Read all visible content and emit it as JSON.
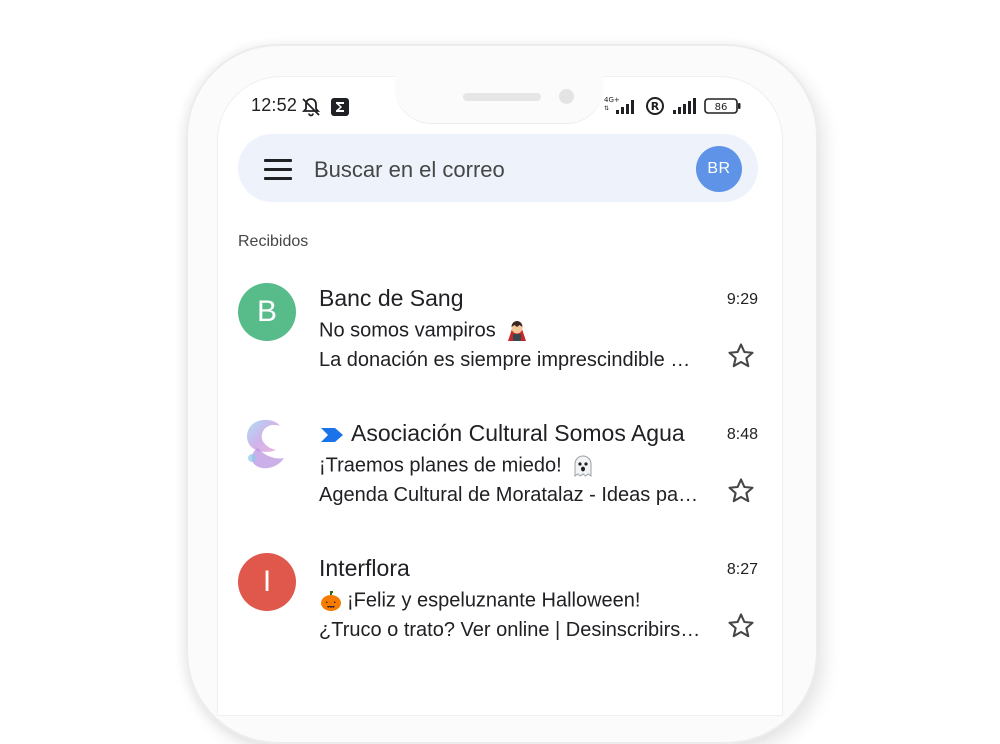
{
  "status_bar": {
    "time": "12:52",
    "network": "4G+",
    "roaming": "R",
    "battery": "86"
  },
  "search": {
    "placeholder": "Buscar en el correo",
    "avatar_initials": "BR",
    "avatar_color": "#5f93e7"
  },
  "inbox": {
    "label": "Recibidos",
    "emails": [
      {
        "avatar_letter": "B",
        "avatar_color": "#57bb8a",
        "sender": "Banc de Sang",
        "time": "9:29",
        "subject": "No somos vampiros",
        "subject_icon": "vampire-emoji",
        "snippet": "La donación es siempre imprescindible …"
      },
      {
        "avatar_letter": "",
        "avatar_color": "#ffffff",
        "sender": "Asociación Cultural Somos Agua",
        "sender_icon": "importance-marker-icon",
        "time": "8:48",
        "subject": "¡Traemos planes de miedo!",
        "subject_icon": "ghost-emoji",
        "snippet": "Agenda Cultural de Moratalaz - Ideas pa…"
      },
      {
        "avatar_letter": "I",
        "avatar_color": "#e0584b",
        "sender": "Interflora",
        "time": "8:27",
        "subject": "¡Feliz y espeluznante Halloween!",
        "subject_icon": "pumpkin-emoji",
        "snippet": "¿Truco o trato? Ver online | Desinscribirs…"
      }
    ]
  }
}
